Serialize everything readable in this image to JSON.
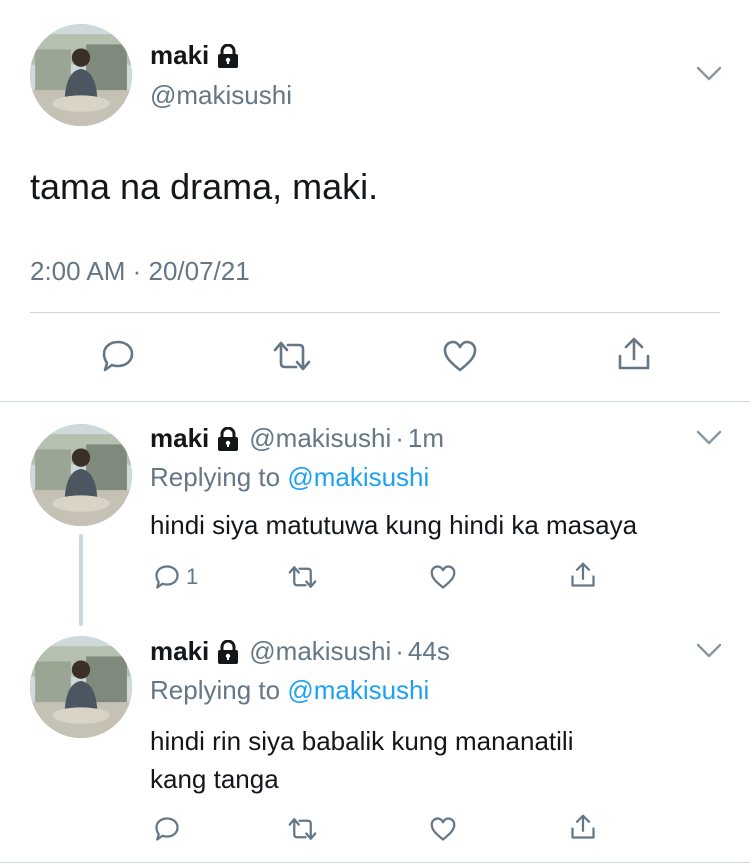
{
  "main_tweet": {
    "display_name": "maki",
    "handle": "@makisushi",
    "text": "tama na drama, maki.",
    "timestamp": "2:00 AM · 20/07/21",
    "locked_icon": "lock-icon"
  },
  "replies": [
    {
      "display_name": "maki",
      "handle": "@makisushi",
      "separator": "·",
      "age": "1m",
      "replying_prefix": "Replying to",
      "replying_to": "@makisushi",
      "text_lines": [
        "hindi siya matutuwa kung hindi ka masaya"
      ],
      "reply_count": "1"
    },
    {
      "display_name": "maki",
      "handle": "@makisushi",
      "separator": "·",
      "age": "44s",
      "replying_prefix": "Replying to",
      "replying_to": "@makisushi",
      "text_lines": [
        "hindi rin siya babalik kung mananatili",
        "kang tanga"
      ],
      "reply_count": ""
    }
  ],
  "icons": {
    "reply": "reply-icon",
    "retweet": "retweet-icon",
    "like": "heart-icon",
    "share": "share-icon",
    "more": "chevron-down-icon"
  },
  "colors": {
    "text": "#14171a",
    "muted": "#657786",
    "link": "#1da1f2",
    "divider": "#ccd6dd"
  }
}
